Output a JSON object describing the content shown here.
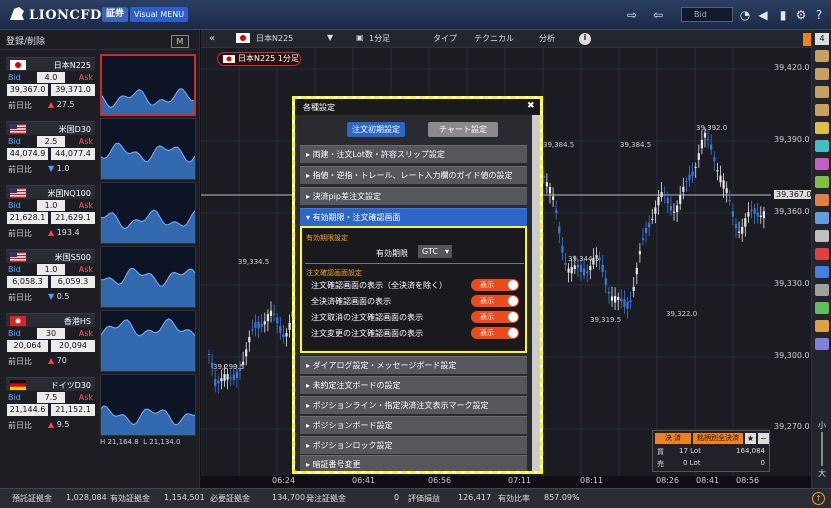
{
  "app": {
    "logo": "LIONCFD",
    "shoken": "証券",
    "visual_menu": "Visual MENU",
    "bid_select": "Bid"
  },
  "left": {
    "register": "登録/削除",
    "m_button": "M"
  },
  "symbols": [
    {
      "name": "日本N225",
      "flag": "jp",
      "spread": "4.0",
      "bid": "39,367.0",
      "ask": "39,371.0",
      "dir": "up",
      "change": "27.5",
      "high": "39,397.0",
      "low": "39,323.5",
      "selected": true
    },
    {
      "name": "米国D30",
      "flag": "us",
      "spread": "2.5",
      "bid": "44,074.9",
      "ask": "44,077.4",
      "dir": "dn",
      "change": "1.0",
      "high": "44,093.9",
      "low": "44,031.4",
      "selected": false
    },
    {
      "name": "米国NQ100",
      "flag": "us",
      "spread": "1.0",
      "bid": "21,628.1",
      "ask": "21,629.1",
      "dir": "up",
      "change": "193.4",
      "high": "21,636.5",
      "low": "21,590.1",
      "selected": false
    },
    {
      "name": "米国S500",
      "flag": "us",
      "spread": "1.0",
      "bid": "6,058.3",
      "ask": "6,059.3",
      "dir": "dn",
      "change": "0.5",
      "high": "6,064.6",
      "low": "6,045.5",
      "selected": false
    },
    {
      "name": "香港HS",
      "flag": "hk",
      "spread": "30",
      "bid": "20,064",
      "ask": "20,094",
      "dir": "up",
      "change": "70",
      "high": "20,091",
      "low": "20,031",
      "selected": false
    },
    {
      "name": "ドイツD30",
      "flag": "de",
      "spread": "7.5",
      "bid": "21,144.6",
      "ask": "21,152.1",
      "dir": "up",
      "change": "9.5",
      "high": "21,164.8",
      "low": "21,134.0",
      "selected": false
    }
  ],
  "labels": {
    "bid": "Bid",
    "ask": "Ask",
    "prev": "前日比",
    "high_prefix": "H",
    "low_prefix": "L"
  },
  "chart_header": {
    "symbol": "日本N225",
    "period": "1分足",
    "type": "タイプ",
    "technical": "テクニカル",
    "analysis": "分析",
    "info": "i",
    "order": "注文"
  },
  "chart_tag": "日本N225 1分足",
  "y_axis": [
    "39,420.0",
    "39,390.0",
    "39,367.0",
    "39,360.0",
    "39,330.0",
    "39,300.0",
    "39,270.0"
  ],
  "x_axis": [
    "06:24",
    "06:41",
    "06:56",
    "07:11",
    "08:11",
    "08:26",
    "08:41",
    "08:56"
  ],
  "annotations": [
    "39,334.5",
    "39,299.5",
    "39,384.5",
    "39,384.5",
    "39,392.0",
    "39,344.5",
    "39,319.5",
    "39,322.0"
  ],
  "dialog": {
    "title": "各種設定",
    "tab_order": "注文初期設定",
    "tab_chart": "チャート設定",
    "sections_before": [
      "両建・注文Lot数・許容スリップ設定",
      "指値・逆指・トレール、レート入力欄のガイド値の設定",
      "決済pip差注文設定"
    ],
    "open_section": "有効期限・注文確認画面",
    "expiry_label": "有効期限設定",
    "expiry_field": "有効期限",
    "expiry_value": "GTC",
    "confirm_label": "注文確認画面設定",
    "toggles": [
      {
        "label": "注文確認画面の表示（全決済を除く）",
        "state": "表示"
      },
      {
        "label": "全決済確認画面の表示",
        "state": "表示"
      },
      {
        "label": "注文取消の注文確認画面の表示",
        "state": "表示"
      },
      {
        "label": "注文変更の注文確認画面の表示",
        "state": "表示"
      }
    ],
    "sections_after": [
      "ダイアログ設定・メッセージボード設定",
      "未約定注文ボードの設定",
      "ポジションライン・指定決済注文表示マーク設定",
      "ポジションボード設定",
      "ポジションロック設定",
      "暗証番号変更"
    ]
  },
  "order_box": {
    "title": "決 済",
    "title2": "銘柄別全決済",
    "buy_label": "買",
    "buy_lot": "17 Lot",
    "buy_price": "164,084",
    "sell_label": "売",
    "sell_lot": "0 Lot",
    "sell_price": "0"
  },
  "right_bar": {
    "count": "4",
    "zoom_small": "小",
    "zoom_big": "大"
  },
  "bottom": [
    {
      "label": "預託証拠金",
      "value": "1,028,084"
    },
    {
      "label": "有効証拠金",
      "value": "1,154,501"
    },
    {
      "label": "必要証拠金",
      "value": "134,700"
    },
    {
      "label": "発注証拠金",
      "value": "0"
    },
    {
      "label": "評価損益",
      "value": "126,417"
    },
    {
      "label": "有効比率",
      "value": "857.09%"
    }
  ]
}
